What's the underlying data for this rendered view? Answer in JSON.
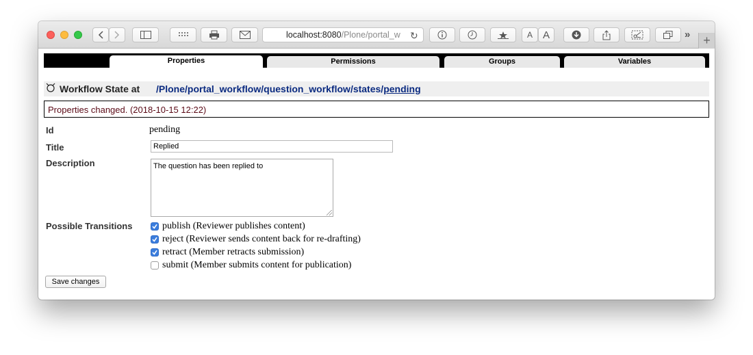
{
  "browser": {
    "address_host": "localhost:8080",
    "address_path": "/Plone/portal_w"
  },
  "tabs": [
    {
      "label": "Properties",
      "active": true
    },
    {
      "label": "Permissions",
      "active": false
    },
    {
      "label": "Groups",
      "active": false
    },
    {
      "label": "Variables",
      "active": false
    }
  ],
  "heading": {
    "label": "Workflow State at",
    "crumbs": [
      "/Plone",
      "/portal_workflow",
      "/question_workflow",
      "/states",
      "/pending"
    ]
  },
  "message": "Properties changed. (2018-10-15 12:22)",
  "form": {
    "id_label": "Id",
    "id_value": "pending",
    "title_label": "Title",
    "title_value": "Replied",
    "description_label": "Description",
    "description_value": "The question has been replied to",
    "transitions_label": "Possible Transitions",
    "transitions": [
      {
        "label": "publish (Reviewer publishes content)",
        "checked": true
      },
      {
        "label": "reject (Reviewer sends content back for re-drafting)",
        "checked": true
      },
      {
        "label": "retract (Member retracts submission)",
        "checked": true
      },
      {
        "label": "submit (Member submits content for publication)",
        "checked": false
      }
    ],
    "save_label": "Save changes"
  },
  "colors": {
    "checkbox_checked": "#3b7ddd",
    "link": "#0a2a80",
    "message_text": "#5a0a16"
  }
}
